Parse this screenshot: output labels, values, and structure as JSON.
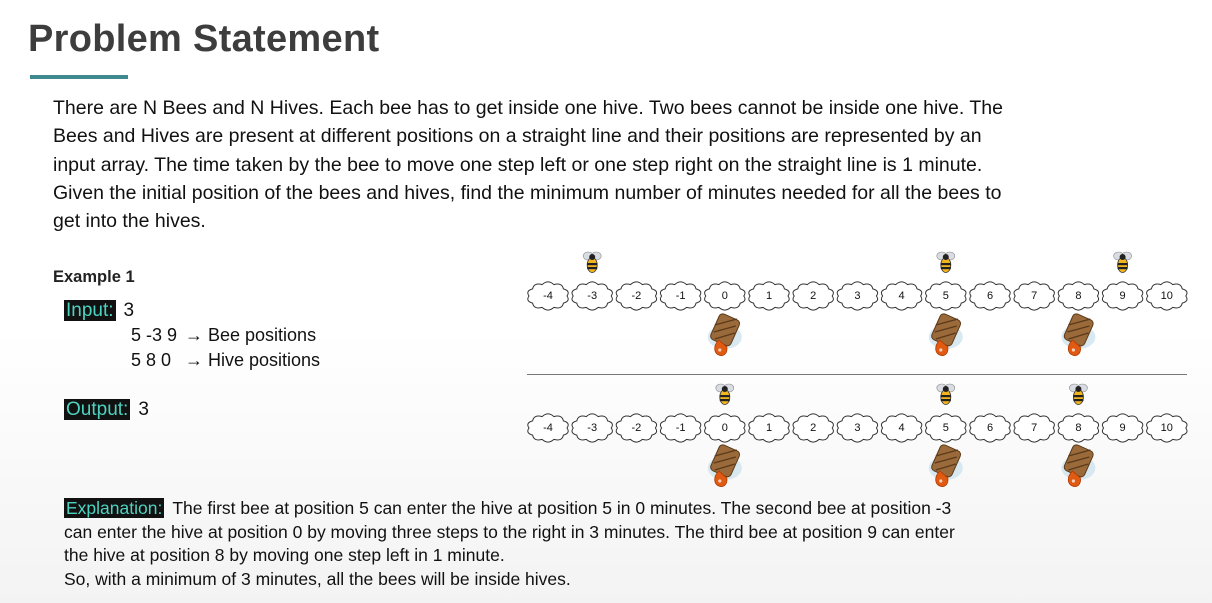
{
  "title": "Problem Statement",
  "paragraph": [
    "There are N Bees and N Hives. Each bee has to get inside one hive. Two bees cannot be inside one hive. The",
    "Bees and Hives are present at different positions on a straight line and their positions are represented by an",
    "input array. The time taken by the bee to move one step left or one step right on the straight line is 1 minute.",
    "Given the initial position of the bees and hives, find the minimum number of minutes needed for all the bees to",
    "get into the hives."
  ],
  "example": {
    "title": "Example 1",
    "input_label": "Input:",
    "input_value": "3",
    "bee_numbers": "5 -3 9",
    "bee_caption": "→ Bee positions",
    "hive_numbers": "5 8 0",
    "hive_caption": "→ Hive positions",
    "output_label": "Output:",
    "output_value": "3"
  },
  "explanation": {
    "label": "Explanation:",
    "lines": [
      "The first bee at position 5 can enter the hive at position 5 in 0 minutes. The second bee at position -3",
      "can enter the hive at position 0 by moving three steps to the right in 3 minutes. The third bee at position 9 can enter",
      "the hive at position 8 by moving one step left in 1 minute.",
      "So, with a minimum of 3 minutes, all the bees will be inside hives."
    ]
  },
  "diagram": {
    "number_line": [
      "-4",
      "-3",
      "-2",
      "-1",
      "0",
      "1",
      "2",
      "3",
      "4",
      "5",
      "6",
      "7",
      "8",
      "9",
      "10"
    ],
    "before": {
      "bees_at": [
        "-3",
        "5",
        "9"
      ],
      "hives_at": [
        "0",
        "5",
        "8"
      ]
    },
    "after": {
      "bees_at": [
        "0",
        "5",
        "8"
      ],
      "hives_at": [
        "0",
        "5",
        "8"
      ]
    },
    "icons": {
      "bee": "bee-icon",
      "hive": "beehive-icon"
    }
  },
  "colors": {
    "title": "#3d3d3d",
    "accent_rule": "#3f8a8e",
    "tag_bg": "#111111",
    "tag_text": "#4ed3c0"
  }
}
